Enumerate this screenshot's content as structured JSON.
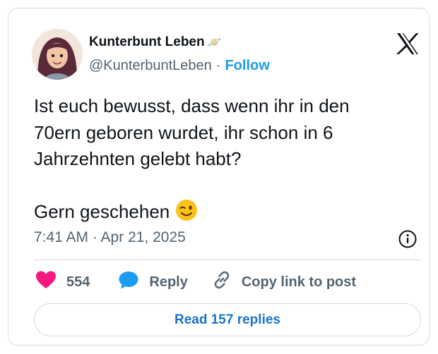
{
  "author": {
    "display_name": "Kunterbunt Leben",
    "name_emoji": "🪐",
    "handle": "@KunterbuntLeben",
    "separator": "·",
    "follow_label": "Follow"
  },
  "tweet": {
    "text": "Ist euch bewusst, dass wenn ihr in den\n70ern geboren wurdet, ihr schon in 6\nJahrzehnten gelebt habt?\n\nGern geschehen",
    "text_emoji": "winking-face-emoji",
    "timestamp": "7:41 AM · Apr 21, 2025"
  },
  "actions": {
    "like_count": "554",
    "reply_label": "Reply",
    "copy_link_label": "Copy link to post"
  },
  "read_replies_label": "Read 157 replies",
  "icons": [
    "avatar",
    "x-logo-icon",
    "winking-face-icon",
    "info-icon",
    "heart-icon",
    "reply-bubble-icon",
    "link-icon"
  ],
  "colors": {
    "like": "#f91880",
    "reply": "#1d9bf0",
    "follow": "#1d9bf0",
    "read_replies": "#1d74c6",
    "muted": "#536471"
  }
}
